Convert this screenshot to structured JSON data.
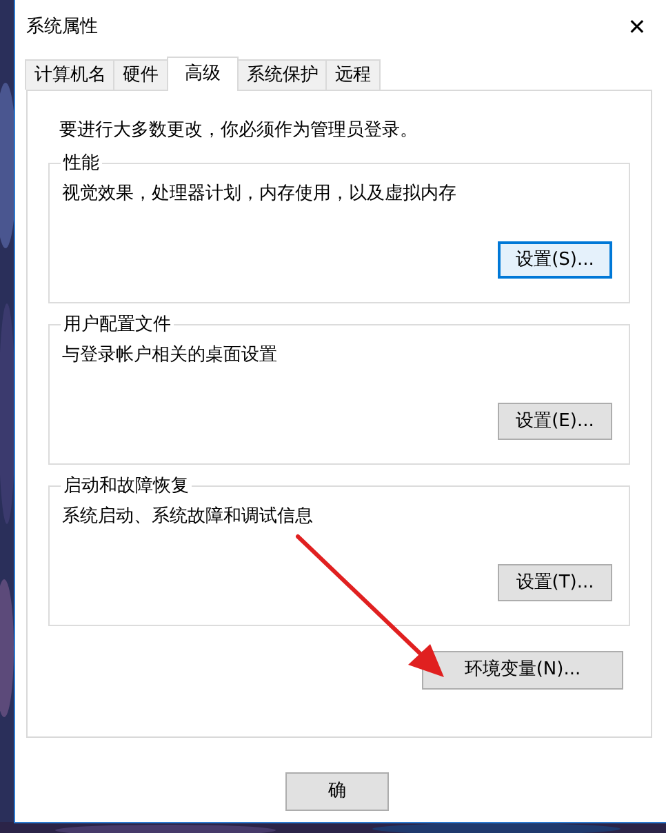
{
  "window": {
    "title": "系统属性",
    "close": "✕"
  },
  "tabs": [
    {
      "label": "计算机名",
      "selected": false
    },
    {
      "label": "硬件",
      "selected": false
    },
    {
      "label": "高级",
      "selected": true
    },
    {
      "label": "系统保护",
      "selected": false
    },
    {
      "label": "远程",
      "selected": false
    }
  ],
  "notice": "要进行大多数更改，你必须作为管理员登录。",
  "groups": [
    {
      "title": "性能",
      "description": "视觉效果，处理器计划，内存使用，以及虚拟内存",
      "button": {
        "label": "设置(S)...",
        "focused": true
      }
    },
    {
      "title": "用户配置文件",
      "description": "与登录帐户相关的桌面设置",
      "button": {
        "label": "设置(E)...",
        "focused": false
      }
    },
    {
      "title": "启动和故障恢复",
      "description": "系统启动、系统故障和调试信息",
      "button": {
        "label": "设置(T)...",
        "focused": false
      }
    }
  ],
  "env_button": {
    "label": "环境变量(N)..."
  },
  "footer_buttons": [
    {
      "label": "确"
    }
  ]
}
